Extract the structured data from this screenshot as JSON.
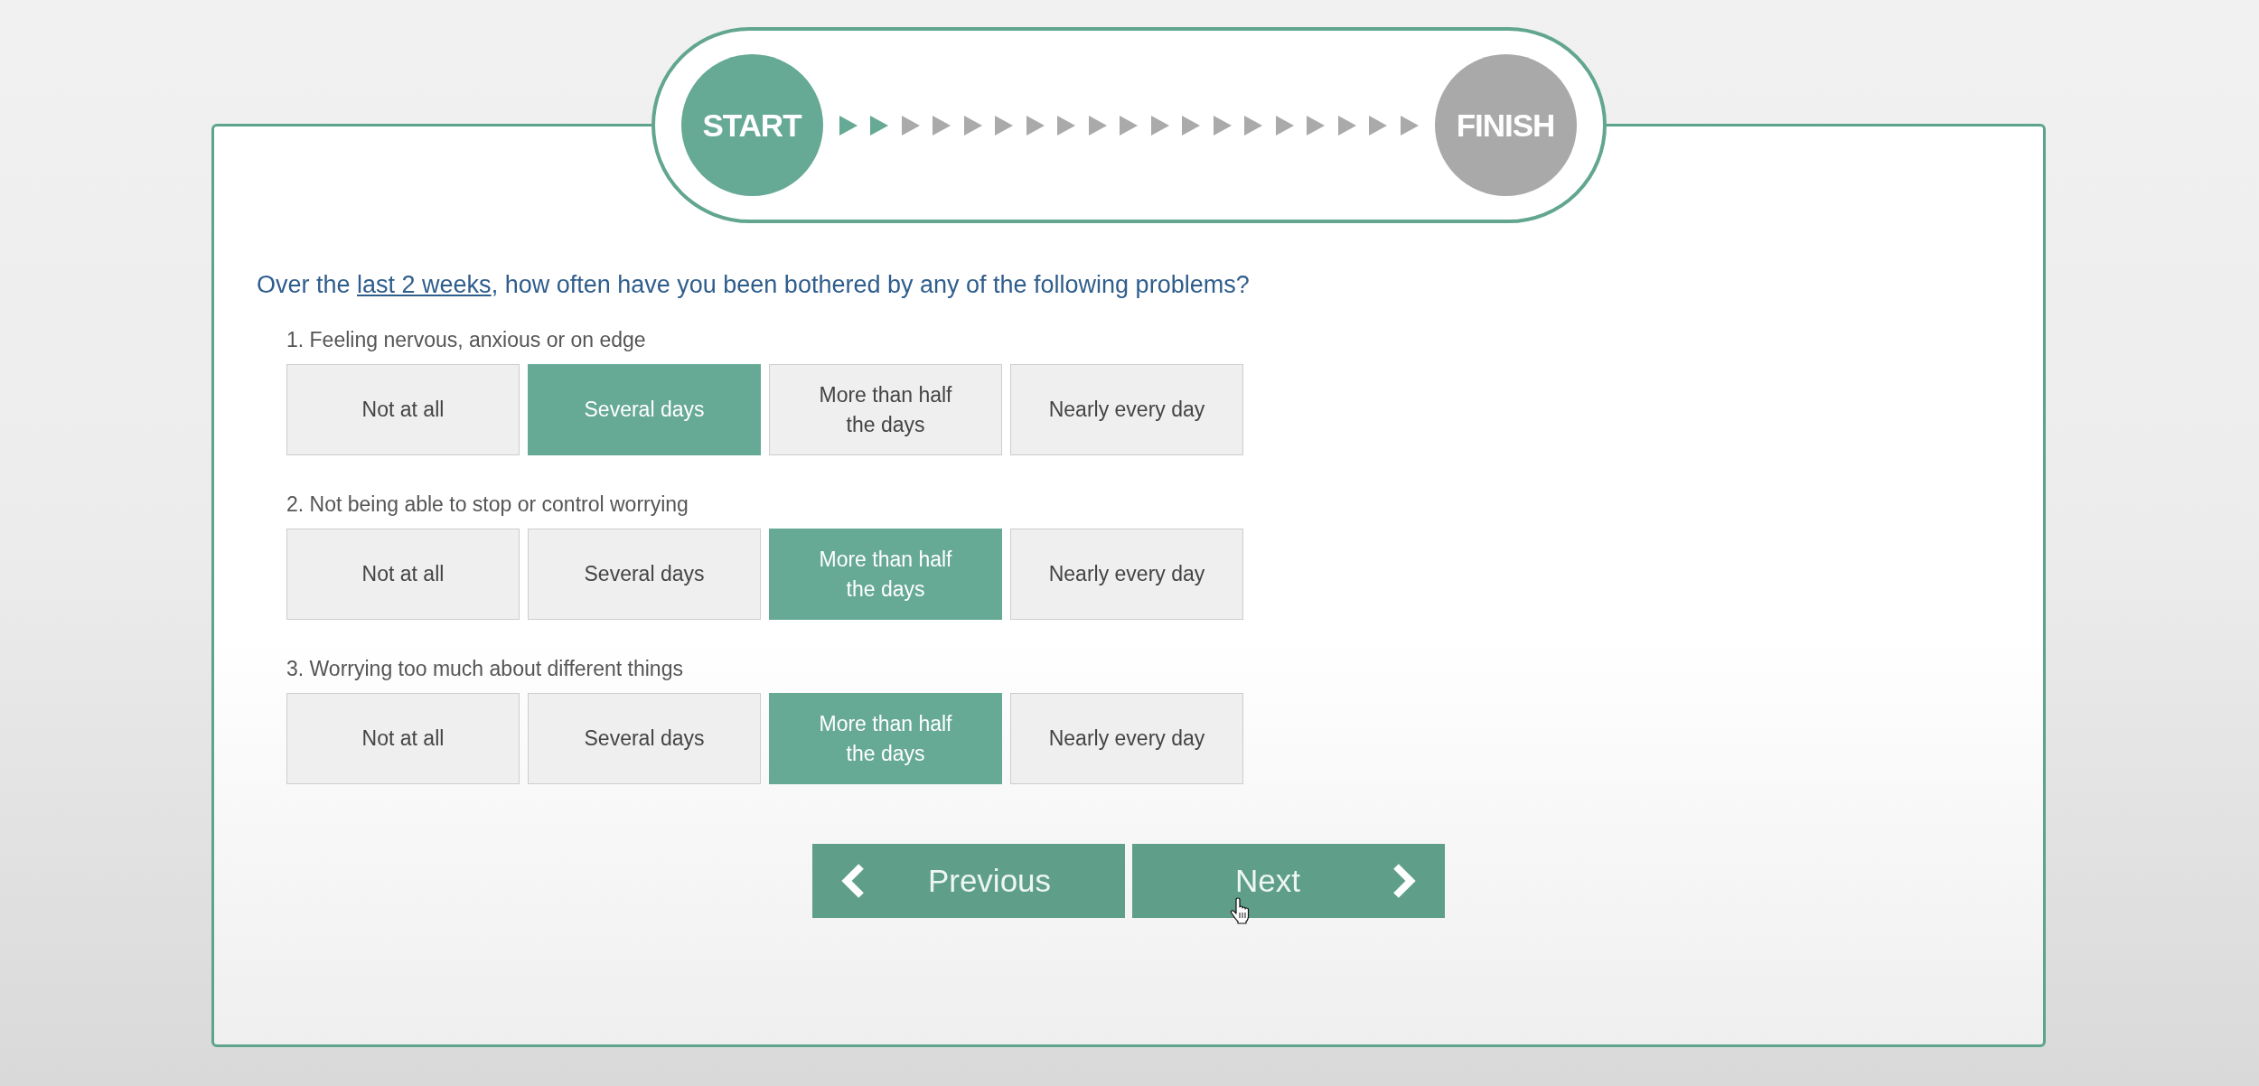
{
  "progress": {
    "start": {
      "label": "START",
      "reached": true
    },
    "steps": [
      {
        "completed": true
      },
      {
        "completed": true
      },
      {
        "completed": false
      },
      {
        "completed": false
      },
      {
        "completed": false
      },
      {
        "completed": false
      },
      {
        "completed": false
      },
      {
        "completed": false
      },
      {
        "completed": false
      },
      {
        "completed": false
      },
      {
        "completed": false
      },
      {
        "completed": false
      },
      {
        "completed": false
      },
      {
        "completed": false
      },
      {
        "completed": false
      },
      {
        "completed": false
      },
      {
        "completed": false
      },
      {
        "completed": false
      },
      {
        "completed": false
      }
    ],
    "finish": {
      "label": "FINISH",
      "reached": false
    }
  },
  "prompt": {
    "text_before": "Over the ",
    "link": "last 2 weeks",
    "text_after": ", how often have you been bothered by any of the following problems?"
  },
  "questions": [
    {
      "label": "1. Feeling nervous, anxious or on edge",
      "options": [
        {
          "label": "Not at all",
          "selected": false
        },
        {
          "label": "Several days",
          "selected": true
        },
        {
          "label": "More than half the days",
          "selected": false
        },
        {
          "label": "Nearly every day",
          "selected": false
        }
      ]
    },
    {
      "label": "2. Not being able to stop or control worrying",
      "options": [
        {
          "label": "Not at all",
          "selected": false
        },
        {
          "label": "Several days",
          "selected": false
        },
        {
          "label": "More than half the days",
          "selected": true
        },
        {
          "label": "Nearly every day",
          "selected": false
        }
      ]
    },
    {
      "label": "3. Worrying too much about different things",
      "options": [
        {
          "label": "Not at all",
          "selected": false
        },
        {
          "label": "Several days",
          "selected": false
        },
        {
          "label": "More than half the days",
          "selected": true
        },
        {
          "label": "Nearly every day",
          "selected": false
        }
      ]
    }
  ],
  "navigation": {
    "previous_label": "Previous",
    "next_label": "Next"
  }
}
